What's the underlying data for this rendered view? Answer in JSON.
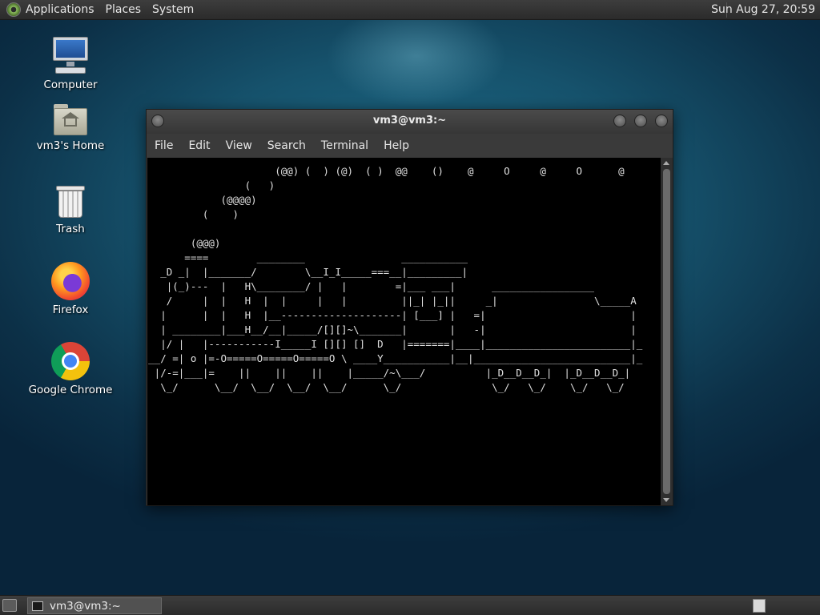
{
  "top_panel": {
    "menus": [
      "Applications",
      "Places",
      "System"
    ],
    "clock": "Sun Aug 27, 20:59"
  },
  "desktop_icons": [
    {
      "label": "Computer",
      "icon": "computer-icon"
    },
    {
      "label": "vm3's Home",
      "icon": "home-folder-icon"
    },
    {
      "label": "Trash",
      "icon": "trash-icon"
    },
    {
      "label": "Firefox",
      "icon": "firefox-icon"
    },
    {
      "label": "Google Chrome",
      "icon": "chrome-icon"
    }
  ],
  "window": {
    "title": "vm3@vm3:~",
    "menu": [
      "File",
      "Edit",
      "View",
      "Search",
      "Terminal",
      "Help"
    ],
    "terminal_text": "                           (@@) (  ) (@)  ( )  @@    ()    @     O     @     O      @\n                      (   )\n                  (@@@@)\n               (    )\n\n             (@@@)\n            ====        ________                ___________\n        _D _|  |_______/        \\__I_I_____===__|_________|\n         |(_)---  |   H\\________/ |   |        =|___ ___|      _________________\n         /     |  |   H  |  |     |   |         ||_| |_||     _|                \\_____A\n        |      |  |   H  |__--------------------| [___] |   =|                        |\n        | ________|___H__/__|_____/[][]~\\_______|       |   -|                        |\n        |/ |   |-----------I_____I [][] []  D   |=======|____|________________________|_\n      __/ =| o |=-O=====O=====O=====O \\ ____Y___________|__|__________________________|_\n       |/-=|___|=    ||    ||    ||    |_____/~\\___/          |_D__D__D_|  |_D__D__D_|\n        \\_/      \\__/  \\__/  \\__/  \\__/      \\_/               \\_/   \\_/    \\_/   \\_/"
  },
  "taskbar": {
    "task_label": "vm3@vm3:~"
  }
}
